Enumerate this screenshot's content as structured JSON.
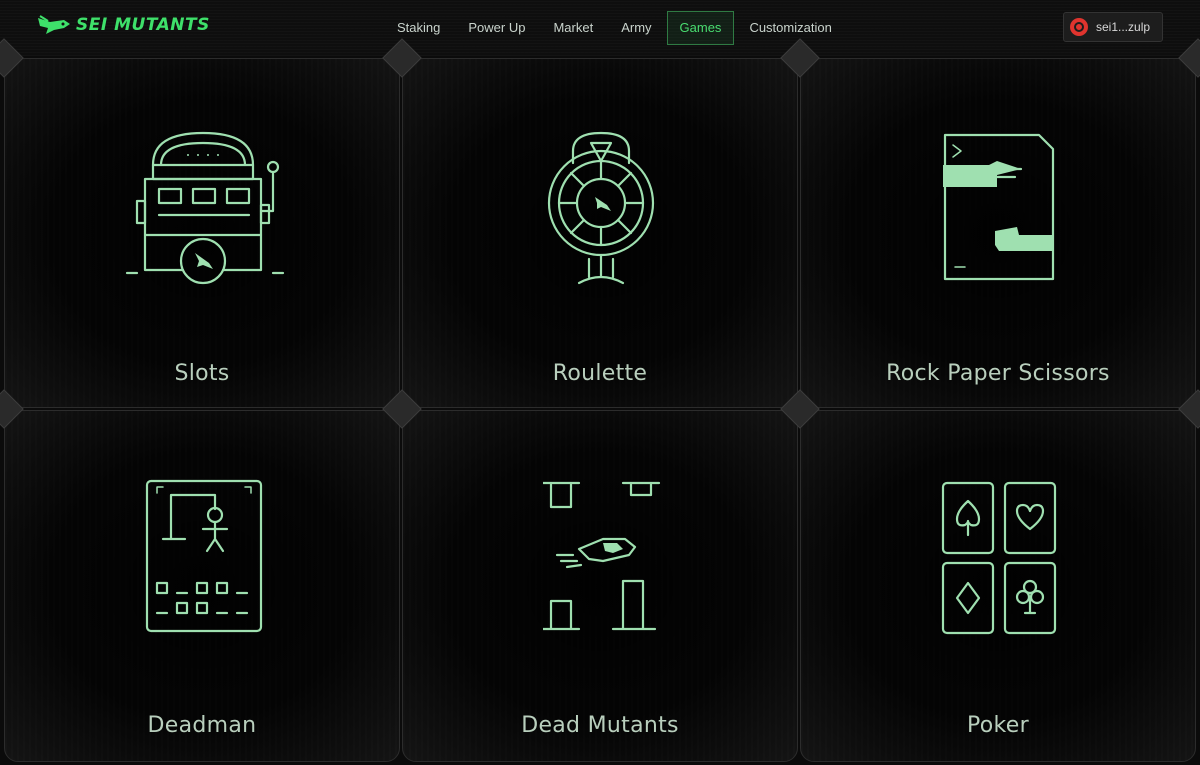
{
  "header": {
    "brand": "SEI MUTANTS",
    "nav": [
      {
        "label": "Staking"
      },
      {
        "label": "Power Up"
      },
      {
        "label": "Market"
      },
      {
        "label": "Army"
      },
      {
        "label": "Games"
      },
      {
        "label": "Customization"
      }
    ],
    "active_nav": "Games",
    "wallet_label": "sei1...zulp"
  },
  "games": [
    {
      "label": "Slots",
      "icon": "slot-machine-icon"
    },
    {
      "label": "Roulette",
      "icon": "roulette-wheel-icon"
    },
    {
      "label": "Rock Paper Scissors",
      "icon": "rock-paper-scissors-icon"
    },
    {
      "label": "Deadman",
      "icon": "hangman-icon"
    },
    {
      "label": "Dead Mutants",
      "icon": "flappy-pipes-icon"
    },
    {
      "label": "Poker",
      "icon": "playing-cards-icon"
    }
  ],
  "colors": {
    "accent": "#3ee06a",
    "icon_stroke": "#9fe0b0",
    "wallet_badge": "#e0342e"
  }
}
